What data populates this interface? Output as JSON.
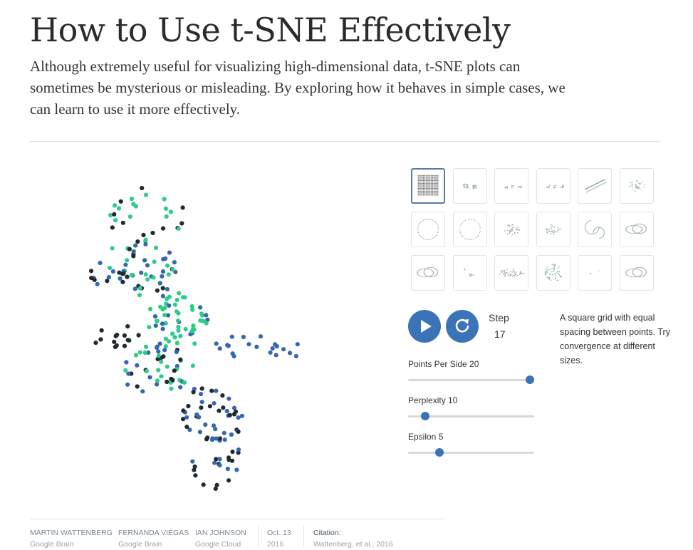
{
  "page": {
    "title": "How to Use t-SNE Effectively",
    "subtitle": "Although extremely useful for visualizing high-dimensional data, t-SNE plots can sometimes be mysterious or misleading. By exploring how it behaves in simple cases, we can learn to use it more effectively."
  },
  "controls": {
    "play_icon": "play-icon",
    "restart_icon": "restart-icon",
    "step_label": "Step",
    "step_value": "17",
    "description": "A square grid with equal spacing between points. Try convergence at different sizes.",
    "sliders": [
      {
        "label": "Points Per Side 20",
        "level": 1.0
      },
      {
        "label": "Perplexity 10",
        "level": 0.11
      },
      {
        "label": "Epsilon 5",
        "level": 0.23
      }
    ]
  },
  "thumbnails": [
    {
      "name": "square-grid"
    },
    {
      "name": "two-clusters"
    },
    {
      "name": "three-clusters"
    },
    {
      "name": "three-clusters-varied"
    },
    {
      "name": "two-long-lines"
    },
    {
      "name": "random-walk"
    },
    {
      "name": "circle-even"
    },
    {
      "name": "circle-uneven"
    },
    {
      "name": "gaussian-cloud"
    },
    {
      "name": "ellipsoidal-cloud"
    },
    {
      "name": "two-links"
    },
    {
      "name": "trefoil-knot"
    },
    {
      "name": "two-rings"
    },
    {
      "name": "subset-clusters"
    },
    {
      "name": "long-gaussian"
    },
    {
      "name": "gaussian-blob"
    },
    {
      "name": "orthogonal-steps"
    },
    {
      "name": "unlinked-rings"
    }
  ],
  "byline": {
    "authors": [
      {
        "name": "MARTIN WATTENBERG",
        "affiliation": "Google Brain"
      },
      {
        "name": "FERNANDA VIÉGAS",
        "affiliation": "Google Brain"
      },
      {
        "name": "IAN JOHNSON",
        "affiliation": "Google Cloud"
      }
    ],
    "date": "Oct. 13",
    "year": "2016",
    "citation_label": "Citation:",
    "citation": "Wattenberg, et al., 2016"
  },
  "colors": {
    "accent": "#3b73b9",
    "dot_dark": "#1f2b30",
    "dot_blue": "#3567b0",
    "dot_green": "#2ecc8a"
  }
}
